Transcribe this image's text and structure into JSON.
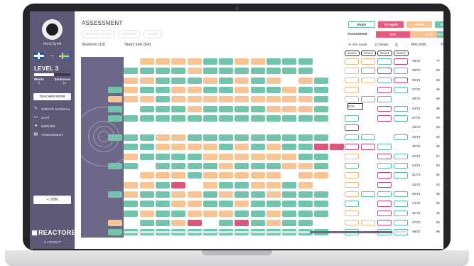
{
  "sidebar": {
    "username": "Henri Syrrili",
    "level": "LEVEL 3",
    "level_progress": 0.55,
    "words_label": "Words",
    "sentences_label": "Sentences",
    "words_value": "71",
    "sentences_value": "26",
    "teacher_mode": "TEACHER MODE",
    "menu": [
      {
        "label": "CREATE MATERIAL",
        "icon": "pencil-icon"
      },
      {
        "label": "CHAT",
        "icon": "chat-icon"
      },
      {
        "label": "GROUPS",
        "icon": "groups-icon"
      },
      {
        "label": "ASSESSMENT",
        "icon": "assessment-icon"
      }
    ],
    "join": "+ JOIN",
    "brand": "REACTORED",
    "logout": "LOGOUT"
  },
  "header": {
    "title": "ASSESSMENT",
    "chips": [
      "SEARCH FILTER",
      "COURSE",
      "CLASS"
    ]
  },
  "legend": {
    "exam": "Exam",
    "try_again": "Try again",
    "good": "Good",
    "excellent": "Excellent"
  },
  "assessment": {
    "label": "Assessment",
    "segments": [
      {
        "value": "50%",
        "color": "#e45a7d",
        "fraction": 0.5
      },
      {
        "value": "",
        "color": "#f7c595",
        "fraction": 0.18
      },
      {
        "value": "37%",
        "color": "#f7c595",
        "fraction": 0.22
      },
      {
        "value": "50%",
        "color": "#72c4ad",
        "fraction": 0.1
      }
    ]
  },
  "controls": {
    "info_mode": "Info mode",
    "details": "Details"
  },
  "table": {
    "students_header": "Students (19)",
    "sets_header": "Study sets (64)",
    "records_header": "Records",
    "percent_header": "%",
    "remate_label": "REMATE",
    "badge": "97%"
  },
  "colors": {
    "teal": "#72c4ad",
    "orange": "#f7c595",
    "pink": "#d9577a",
    "outline_teal": "#5cbca6",
    "outline_pink": "#c2447b",
    "outline_orange": "#f0b980"
  },
  "rows": [
    {
      "cells": "..oooottoottt..",
      "outlines": "ootp",
      "records": "46/72",
      "pct": "77"
    },
    {
      "cells": ".ttttottttttt..",
      "outlines": "otpt",
      "records": "43/72",
      "pct": "89"
    },
    {
      "cells": ".ootttototo.ot.",
      "outlines": "ootp",
      "records": "50/72",
      "pct": "53"
    },
    {
      "cells": "tottoottottott.",
      "outlines": "o.pt",
      "records": "37/72",
      "pct": "65"
    },
    {
      "cells": "oootooooooooot.",
      "outlines": "ott.",
      "records": "48/72",
      "pct": "85"
    },
    {
      "cells": "t.tttottttooot.",
      "outlines": "b.pt",
      "records": "44/72",
      "pct": "98"
    },
    {
      "cells": "tttttttttttttt.",
      "outlines": "t.pt",
      "records": "57/72",
      "pct": "94"
    },
    {
      "cells": "...............",
      "outlines": "p...",
      "records": "16/72",
      "pct": "52"
    },
    {
      "cells": "tttoottttttttt.",
      "outlines": "tt.t",
      "records": "45/72",
      "pct": "92"
    },
    {
      "cells": ".ttoooototottpp",
      "outlines": "ppt.",
      "records": "32/72",
      "pct": "36"
    },
    {
      "cells": ".ottttoooooott.",
      "outlines": "o.pt",
      "records": "47/72",
      "pct": "87"
    },
    {
      "cells": "tt.ttttotttoot.",
      "outlines": "t.tt",
      "records": "53/72",
      "pct": "94"
    },
    {
      "cells": "..oootooooo.oo.",
      "outlines": "o.pt",
      "records": "51/72",
      "pct": "81"
    },
    {
      "cells": ".ootp.ottooto..",
      "outlines": "o.p.",
      "records": "45/72",
      "pct": "43"
    },
    {
      "cells": "tottootottottt.",
      "outlines": "ottt",
      "records": "50/72",
      "pct": "92"
    },
    {
      "cells": ".tttoottottttt.",
      "outlines": "t.pt",
      "records": "44/72",
      "pct": "86"
    },
    {
      "cells": ".tottooottottt.",
      "outlines": "o.pt",
      "records": "31/72",
      "pct": "46"
    },
    {
      "cells": "o.ttop.tptott..",
      "outlines": "oopt",
      "records": "37/72",
      "pct": "82"
    },
    {
      "cells": "tttttttttttttt.",
      "outlines": "t.tt",
      "records": "49/72",
      "pct": "95"
    }
  ]
}
